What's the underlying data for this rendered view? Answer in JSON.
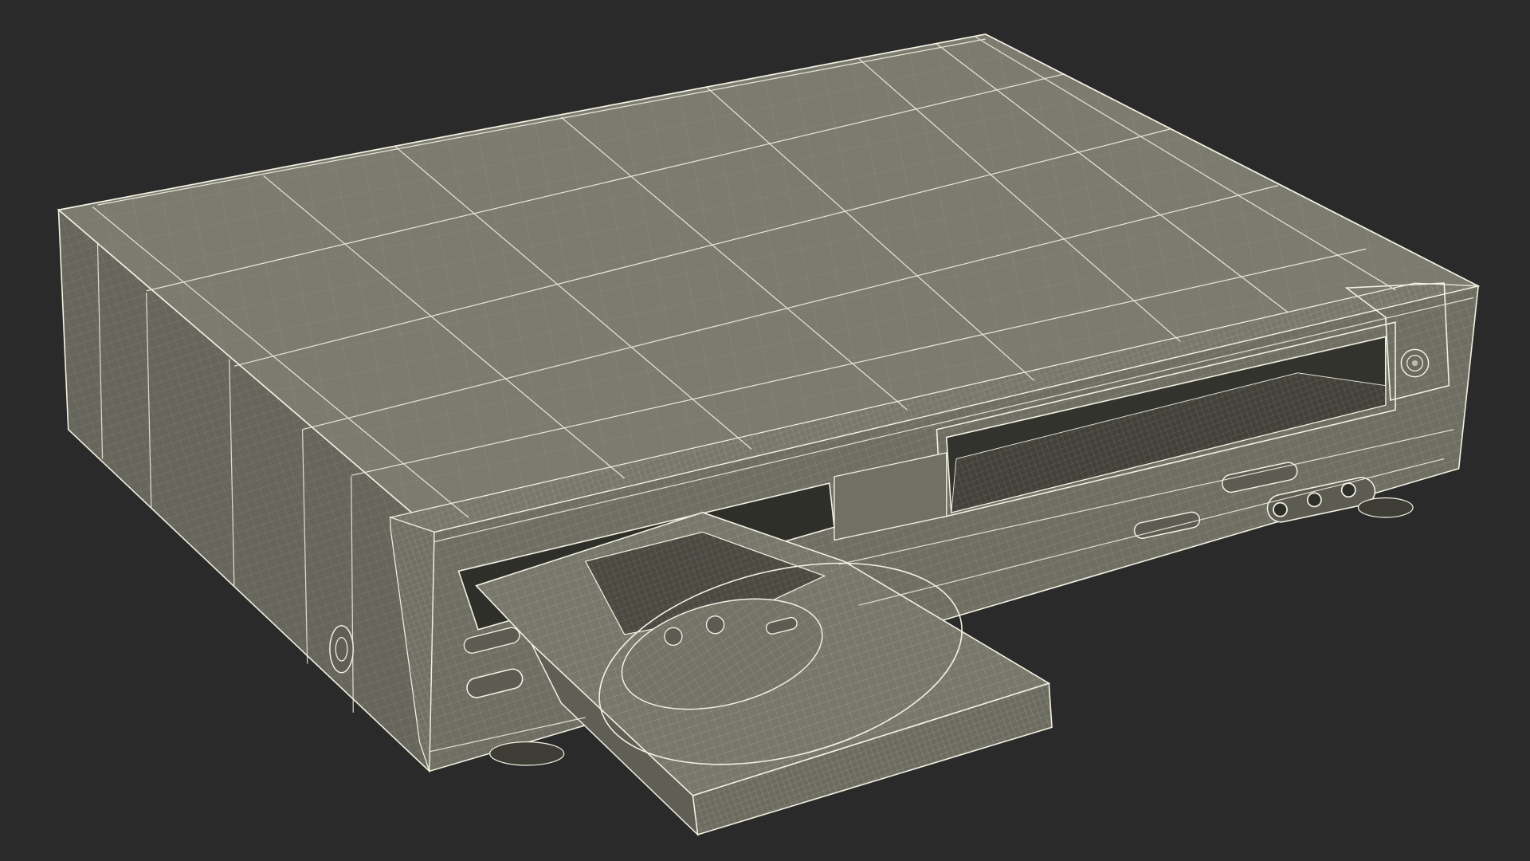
{
  "scene": {
    "subject": "wireframe-dvd-vcr-combo-player",
    "colors": {
      "background": "#2a2a2a",
      "surface_top": "#7b7b6f",
      "surface_front": "#6e6e63",
      "surface_side": "#66665c",
      "surface_dark": "#3a3a34",
      "wire": "#f2f1e2"
    }
  }
}
